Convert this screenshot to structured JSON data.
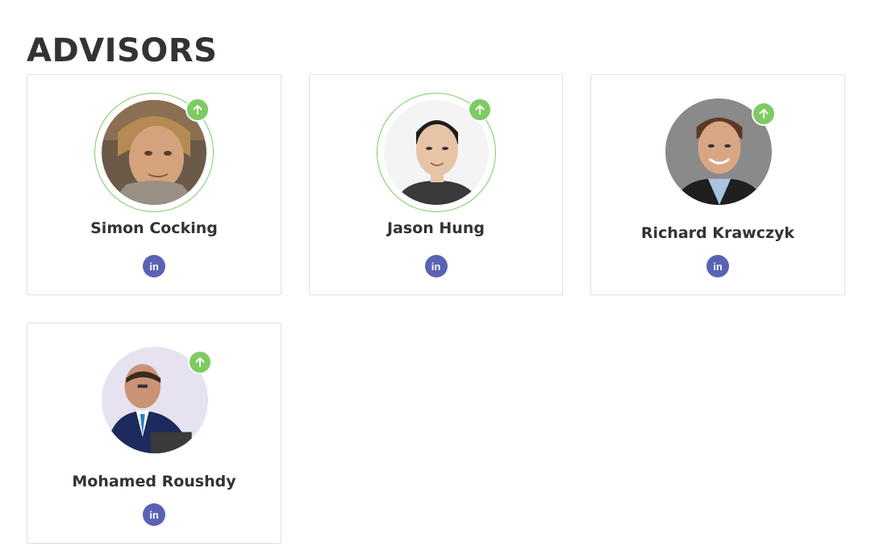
{
  "section": {
    "title": "ADVISORS"
  },
  "colors": {
    "badge": "#7dcb63",
    "ring": "#7dcb63",
    "linkedin": "#5a63b3",
    "text": "#333333"
  },
  "advisors": [
    {
      "name": "Simon Cocking",
      "avatar_icon": "person-photo",
      "badge_icon": "arrow-up-icon",
      "linkedin_label": "in",
      "ring": true
    },
    {
      "name": "Jason Hung",
      "avatar_icon": "person-photo",
      "badge_icon": "arrow-up-icon",
      "linkedin_label": "in",
      "ring": true
    },
    {
      "name": "Richard Krawczyk",
      "avatar_icon": "person-photo",
      "badge_icon": "arrow-up-icon",
      "linkedin_label": "in",
      "ring": false
    },
    {
      "name": "Mohamed Roushdy",
      "avatar_icon": "person-photo",
      "badge_icon": "arrow-up-icon",
      "linkedin_label": "in",
      "ring": false
    }
  ]
}
